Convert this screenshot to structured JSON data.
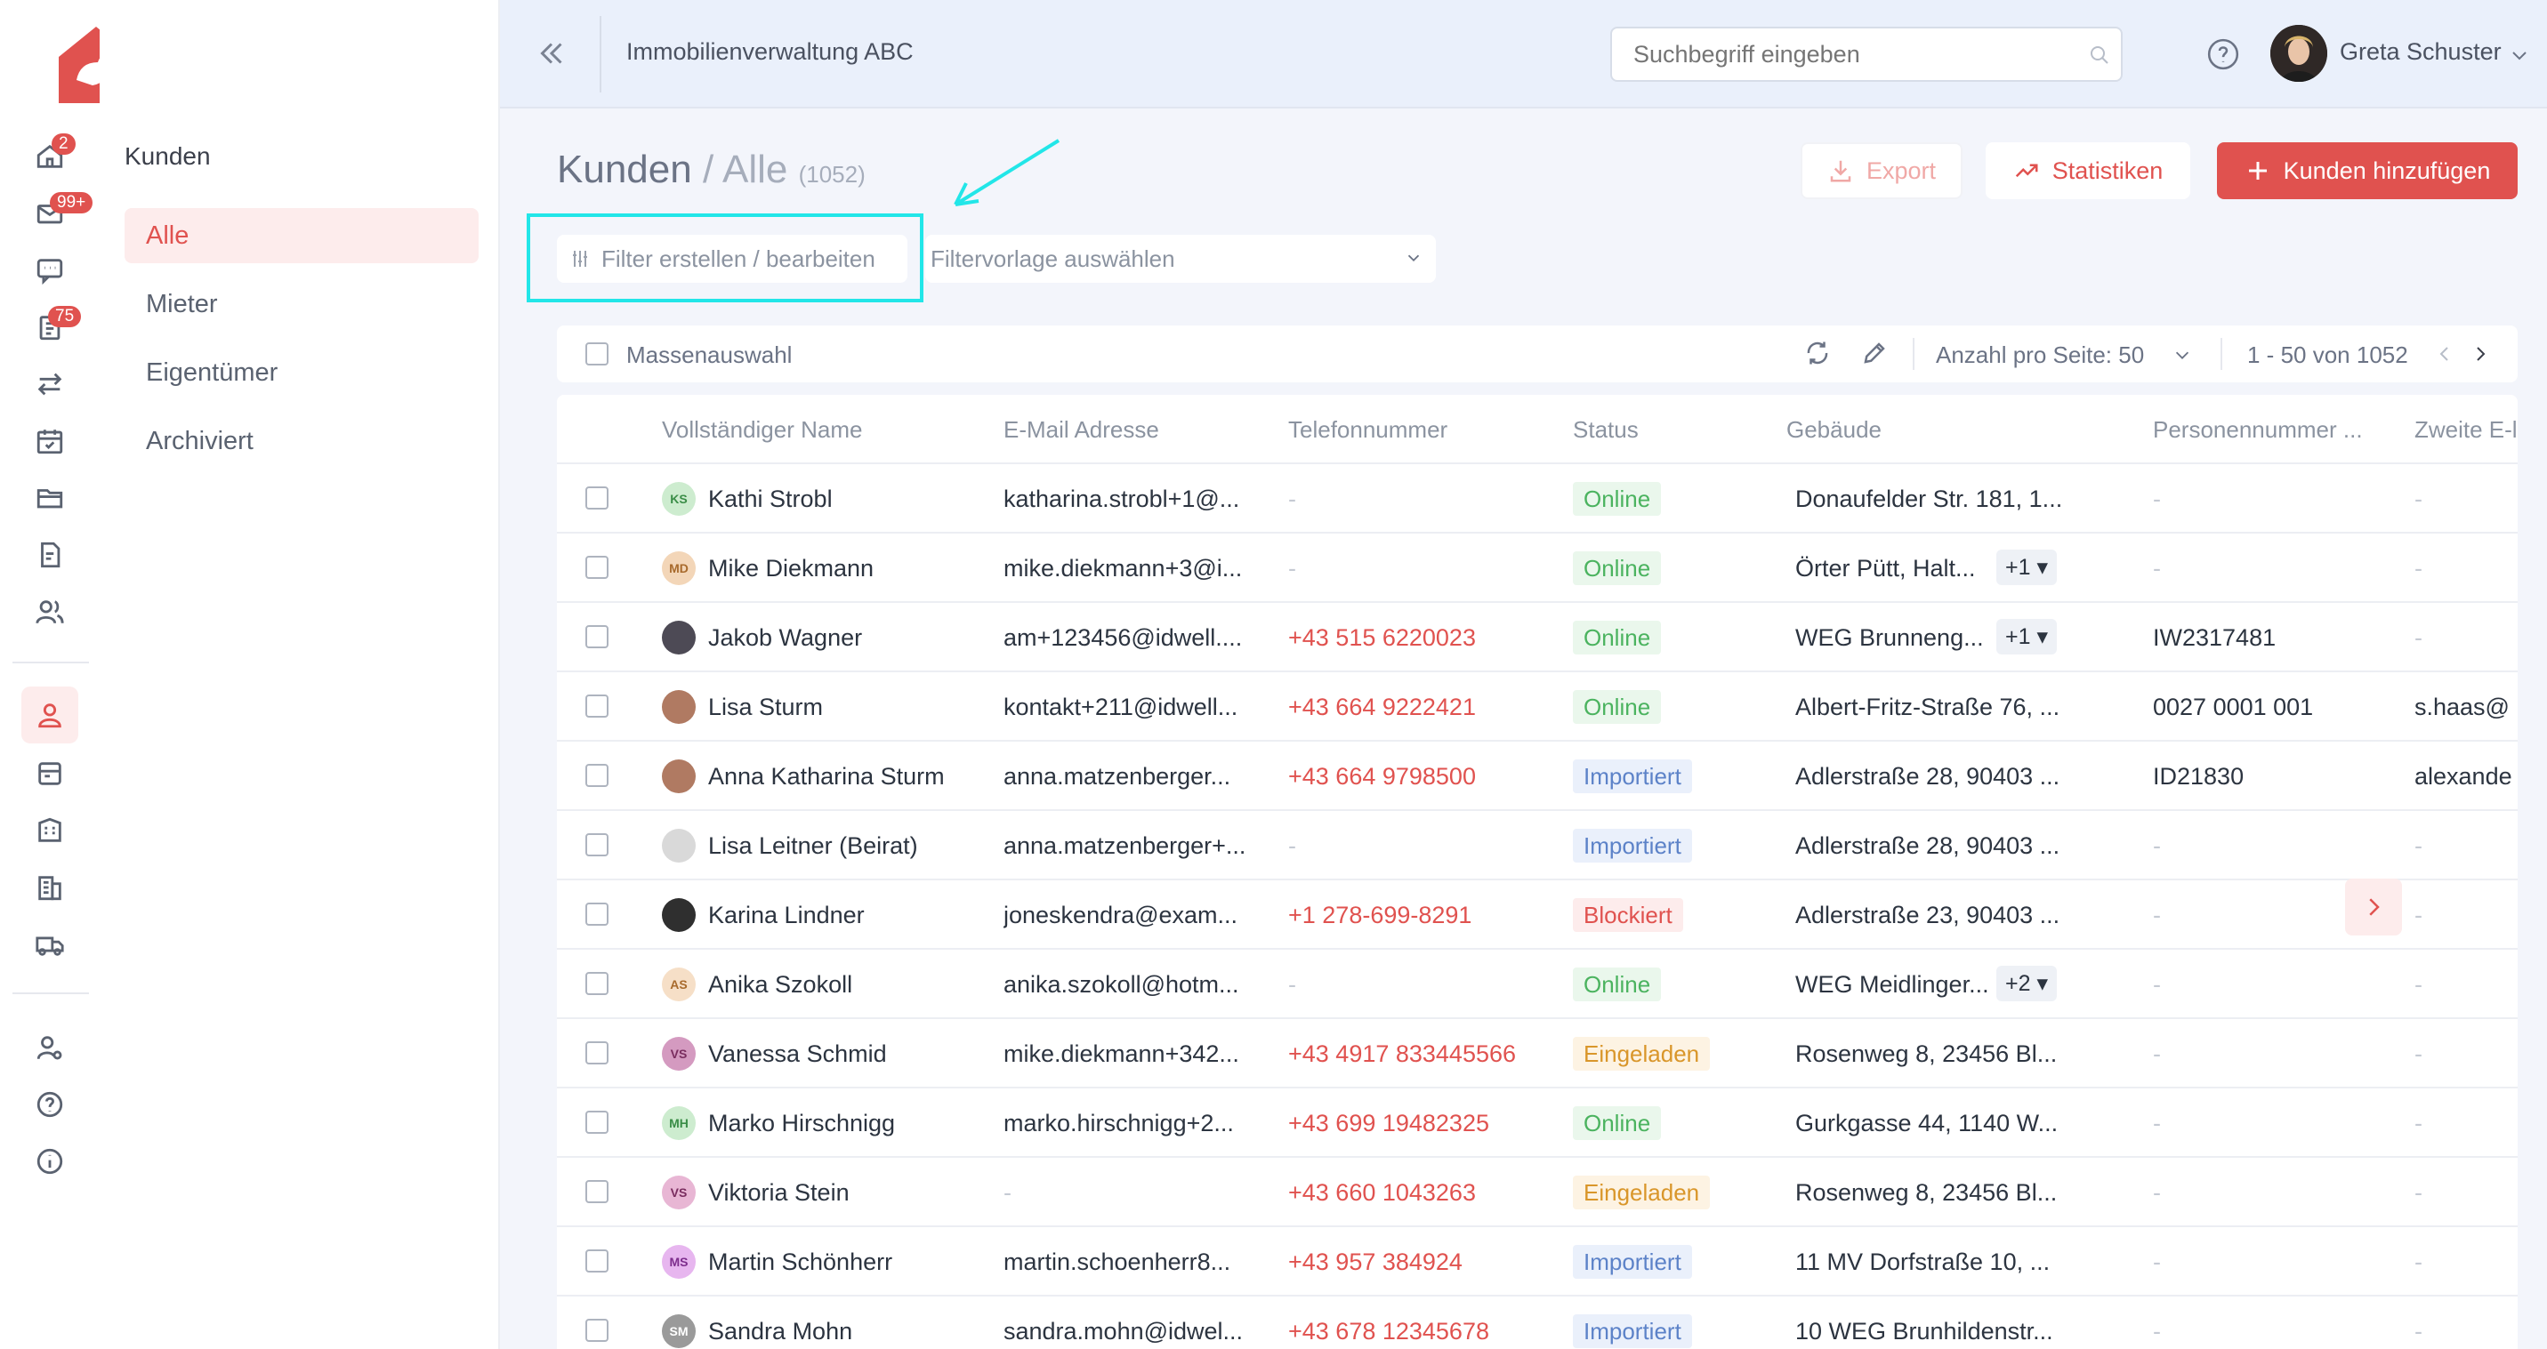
{
  "app": {
    "logo_text": "idwell",
    "brand_color": "#e0524f"
  },
  "rail": {
    "badges": {
      "home": "2",
      "mail": "99+",
      "tasks": "75"
    }
  },
  "subnav": {
    "title": "Kunden",
    "items": [
      {
        "label": "Alle",
        "active": true
      },
      {
        "label": "Mieter"
      },
      {
        "label": "Eigentümer"
      },
      {
        "label": "Archiviert"
      }
    ]
  },
  "header": {
    "company": "Immobilienverwaltung ABC",
    "search_placeholder": "Suchbegriff eingeben",
    "user_name": "Greta Schuster"
  },
  "page": {
    "title": "Kunden",
    "separator": "/",
    "subtitle": "Alle",
    "count": "(1052)",
    "export_label": "Export",
    "stats_label": "Statistiken",
    "add_label": "Kunden hinzufügen"
  },
  "filters": {
    "filter_button": "Filter erstellen / bearbeiten",
    "template_placeholder": "Filtervorlage auswählen"
  },
  "toolbar": {
    "mass_select": "Massenauswahl",
    "per_page_label": "Anzahl pro Seite:",
    "per_page_value": "50",
    "range": "1 - 50 von 1052"
  },
  "table": {
    "columns": [
      "Vollständiger Name",
      "E-Mail Adresse",
      "Telefonnummer",
      "Status",
      "Gebäude",
      "Personennummer ...",
      "Zweite E-l"
    ],
    "rows": [
      {
        "initials": "KS",
        "avatar_bg": "#cdeccf",
        "avatar_fg": "#3a8d47",
        "name": "Kathi Strobl",
        "email": "katharina.strobl+1@...",
        "phone": "-",
        "status": "Online",
        "status_kind": "online",
        "building": "Donaufelder Str. 181, 1...",
        "more": "",
        "person_no": "-",
        "second_email": "-"
      },
      {
        "initials": "MD",
        "avatar_bg": "#f3d6b8",
        "avatar_fg": "#a86a2c",
        "name": "Mike Diekmann",
        "email": "mike.diekmann+3@i...",
        "phone": "-",
        "status": "Online",
        "status_kind": "online",
        "building": "Örter Pütt, Halt...",
        "more": "+1 ▾",
        "person_no": "-",
        "second_email": "-"
      },
      {
        "initials": "",
        "avatar_bg": "#4d4a55",
        "avatar_fg": "#ffffff",
        "name": "Jakob Wagner",
        "email": "am+123456@idwell....",
        "phone": "+43 515 6220023",
        "status": "Online",
        "status_kind": "online",
        "building": "WEG Brunneng...",
        "more": "+1 ▾",
        "person_no": "IW2317481",
        "second_email": "-"
      },
      {
        "initials": "",
        "avatar_bg": "#b07a62",
        "avatar_fg": "#ffffff",
        "name": "Lisa Sturm",
        "email": "kontakt+211@idwell...",
        "phone": "+43 664 9222421",
        "status": "Online",
        "status_kind": "online",
        "building": "Albert-Fritz-Straße 76, ...",
        "more": "",
        "person_no": "0027 0001 001",
        "second_email": "s.haas@"
      },
      {
        "initials": "",
        "avatar_bg": "#b07a62",
        "avatar_fg": "#ffffff",
        "name": "Anna Katharina Sturm",
        "email": "anna.matzenberger...",
        "phone": "+43 664 9798500",
        "status": "Importiert",
        "status_kind": "importiert",
        "building": "Adlerstraße 28, 90403 ...",
        "more": "",
        "person_no": "ID21830",
        "second_email": "alexande"
      },
      {
        "initials": "",
        "avatar_bg": "#d9d9d9",
        "avatar_fg": "#333333",
        "name": "Lisa Leitner (Beirat)",
        "email": "anna.matzenberger+...",
        "phone": "-",
        "status": "Importiert",
        "status_kind": "importiert",
        "building": "Adlerstraße 28, 90403 ...",
        "more": "",
        "person_no": "-",
        "second_email": "-"
      },
      {
        "initials": "",
        "avatar_bg": "#2f2f2f",
        "avatar_fg": "#ffffff",
        "name": "Karina Lindner",
        "email": "joneskendra@exam...",
        "phone": "+1 278-699-8291",
        "status": "Blockiert",
        "status_kind": "blockiert",
        "building": "Adlerstraße 23, 90403 ...",
        "more": "",
        "person_no": "-",
        "second_email": "-"
      },
      {
        "initials": "AS",
        "avatar_bg": "#f6dfc7",
        "avatar_fg": "#a86a2c",
        "name": "Anika Szokoll",
        "email": "anika.szokoll@hotm...",
        "phone": "-",
        "status": "Online",
        "status_kind": "online",
        "building": "WEG Meidlinger...",
        "more": "+2 ▾",
        "person_no": "-",
        "second_email": "-"
      },
      {
        "initials": "VS",
        "avatar_bg": "#d49ac0",
        "avatar_fg": "#7a2d5f",
        "name": "Vanessa Schmid",
        "email": "mike.diekmann+342...",
        "phone": "+43 4917 833445566",
        "status": "Eingeladen",
        "status_kind": "eingeladen",
        "building": "Rosenweg 8, 23456 Bl...",
        "more": "",
        "person_no": "-",
        "second_email": "-"
      },
      {
        "initials": "MH",
        "avatar_bg": "#cdeccf",
        "avatar_fg": "#3a8d47",
        "name": "Marko Hirschnigg",
        "email": "marko.hirschnigg+2...",
        "phone": "+43 699 19482325",
        "status": "Online",
        "status_kind": "online",
        "building": "Gurkgasse 44, 1140 W...",
        "more": "",
        "person_no": "-",
        "second_email": "-"
      },
      {
        "initials": "VS",
        "avatar_bg": "#e8b6d4",
        "avatar_fg": "#7a2d5f",
        "name": "Viktoria Stein",
        "email": "-",
        "phone": "+43 660 1043263",
        "status": "Eingeladen",
        "status_kind": "eingeladen",
        "building": "Rosenweg 8, 23456 Bl...",
        "more": "",
        "person_no": "-",
        "second_email": "-"
      },
      {
        "initials": "MS",
        "avatar_bg": "#e7b6ef",
        "avatar_fg": "#7d2d8c",
        "name": "Martin Schönherr",
        "email": "martin.schoenherr8...",
        "phone": "+43 957 384924",
        "status": "Importiert",
        "status_kind": "importiert",
        "building": "11 MV Dorfstraße 10, ...",
        "more": "",
        "person_no": "-",
        "second_email": "-"
      },
      {
        "initials": "SM",
        "avatar_bg": "#9a9a9a",
        "avatar_fg": "#ffffff",
        "name": "Sandra Mohn",
        "email": "sandra.mohn@idwel...",
        "phone": "+43 678 12345678",
        "status": "Importiert",
        "status_kind": "importiert",
        "building": "10 WEG Brunhildenstr...",
        "more": "",
        "person_no": "-",
        "second_email": "-"
      }
    ]
  }
}
